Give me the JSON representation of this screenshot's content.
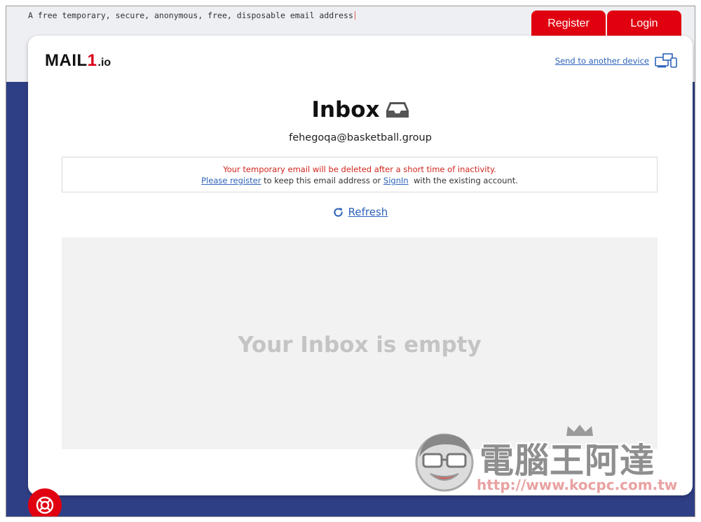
{
  "header": {
    "tagline": "A free temporary, secure, anonymous, free, disposable email address",
    "register_label": "Register",
    "login_label": "Login"
  },
  "brand": {
    "logo_main": "MAIL",
    "logo_one": "1",
    "logo_tld": ".io"
  },
  "toolbar": {
    "send_device_label": "Send to another device",
    "send_device_icon": "device-transfer-icon"
  },
  "inbox": {
    "title": "Inbox",
    "title_icon": "inbox-tray-icon",
    "email": "fehegoqa@basketball.group",
    "notice_line1": "Your temporary email will be deleted after a short time of inactivity.",
    "notice_register_link": "Please register",
    "notice_mid": " to keep this email address or ",
    "notice_signin_link": "SignIn",
    "notice_end": "  with the existing account.",
    "refresh_label": "Refresh",
    "refresh_icon": "refresh-icon",
    "empty_message": "Your Inbox is empty"
  },
  "help": {
    "icon": "lifebuoy-icon"
  },
  "watermark": {
    "title": "電腦王阿達",
    "url": "http://www.kocpc.com.tw"
  },
  "colors": {
    "accent_red": "#e0000f",
    "link_blue": "#2d63b8",
    "background_navy": "#2f3f85",
    "warning_red": "#d0261e"
  }
}
